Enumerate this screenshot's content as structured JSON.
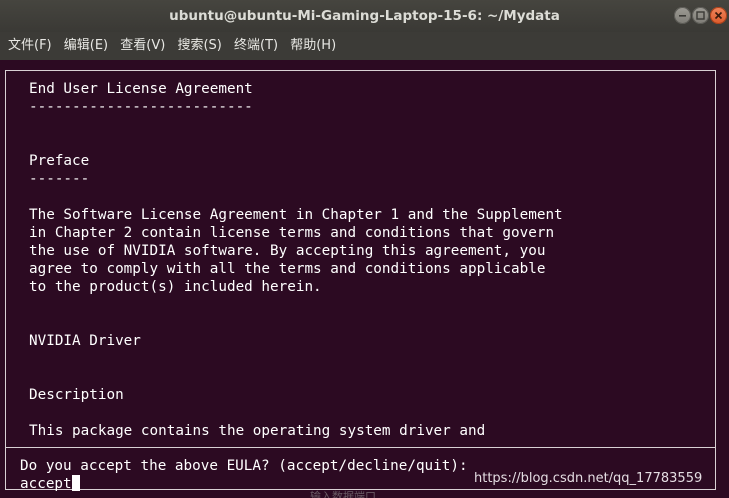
{
  "window": {
    "title": "ubuntu@ubuntu-Mi-Gaming-Laptop-15-6: ~/Mydata",
    "controls": [
      "minimize-icon",
      "maximize-icon",
      "close-icon"
    ]
  },
  "menu": {
    "items": [
      {
        "label": "文件(F)"
      },
      {
        "label": "编辑(E)"
      },
      {
        "label": "查看(V)"
      },
      {
        "label": "搜索(S)"
      },
      {
        "label": "终端(T)"
      },
      {
        "label": "帮助(H)"
      }
    ]
  },
  "terminal": {
    "colors": {
      "background": "#2c0a22",
      "foreground": "#ffffff",
      "frame": "#d8d0d4"
    },
    "document_lines": [
      "End User License Agreement",
      "--------------------------",
      "",
      "",
      "Preface",
      "-------",
      "",
      "The Software License Agreement in Chapter 1 and the Supplement",
      "in Chapter 2 contain license terms and conditions that govern",
      "the use of NVIDIA software. By accepting this agreement, you",
      "agree to comply with all the terms and conditions applicable",
      "to the product(s) included herein.",
      "",
      "",
      "NVIDIA Driver",
      "",
      "",
      "Description",
      "",
      "This package contains the operating system driver and"
    ],
    "prompt": "Do you accept the above EULA? (accept/decline/quit):",
    "input_value": "accept"
  },
  "watermark": "https://blog.csdn.net/qq_17783559",
  "faint_overlay_text": "输入数据端口"
}
